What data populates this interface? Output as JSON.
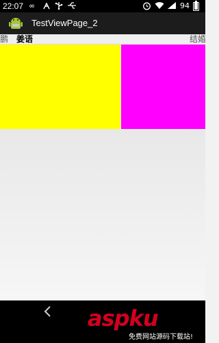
{
  "status_bar": {
    "time": "22:07",
    "battery_text": "94",
    "battery_level_percent": 94,
    "icons": [
      "infinity-icon",
      "usb-debug-icon",
      "usb-icon",
      "usb-plug-icon",
      "alarm-icon",
      "wifi-icon",
      "signal-icon",
      "battery-icon"
    ]
  },
  "action_bar": {
    "title": "TestViewPage_2",
    "icon": "android-icon"
  },
  "tabs": {
    "prev": "王鹏",
    "current": "姜语",
    "next": "结婚"
  },
  "pages": {
    "colors": [
      "#ffff00",
      "#ff00ff"
    ]
  },
  "nav_bar": {
    "back_icon": "back-chevron-icon"
  },
  "watermark": {
    "logo": "aspku",
    "tagline": "免费网站源码下载站!",
    "logo_color": "#d2001f"
  }
}
